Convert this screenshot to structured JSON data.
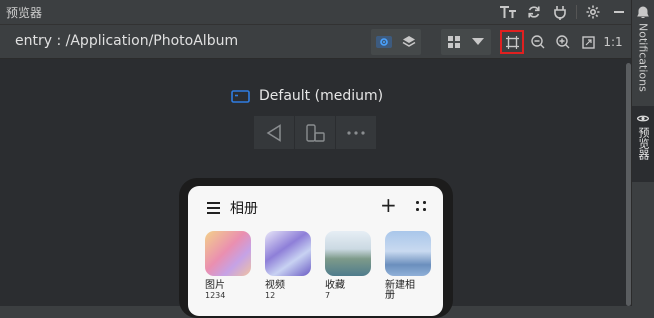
{
  "window": {
    "title": "预览器"
  },
  "toolbar": {
    "path": "entry : /Application/PhotoAlbum",
    "scale_label": "1:1"
  },
  "sidebar": {
    "notifications": "Notifications",
    "previewer": "预览器"
  },
  "device": {
    "name": "Default (medium)"
  },
  "app": {
    "title": "相册",
    "albums": [
      {
        "name": "图片",
        "count": "1234"
      },
      {
        "name": "视频",
        "count": "12"
      },
      {
        "name": "收藏",
        "count": "7"
      },
      {
        "name": "新建相册",
        "count": ""
      }
    ]
  },
  "colors": {
    "accent": "#2f7de1",
    "highlight": "#e02020",
    "background": "#2b2d30"
  }
}
